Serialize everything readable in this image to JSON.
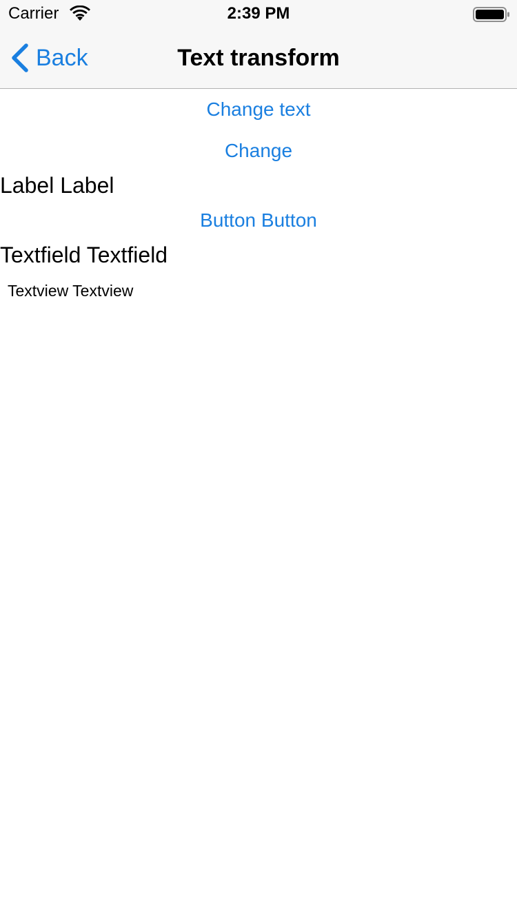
{
  "status_bar": {
    "carrier": "Carrier",
    "time": "2:39 PM",
    "wifi_icon": "wifi-icon",
    "battery_icon": "battery-icon"
  },
  "nav": {
    "back_label": "Back",
    "title": "Text transform",
    "accent_color": "#1a7fe0"
  },
  "content": {
    "change_text_button": "Change text",
    "change_button": "Change",
    "label_text": "Label Label",
    "button_text": "Button Button",
    "textfield_value": "Textfield Textfield",
    "textview_text": "Textview Textview"
  }
}
